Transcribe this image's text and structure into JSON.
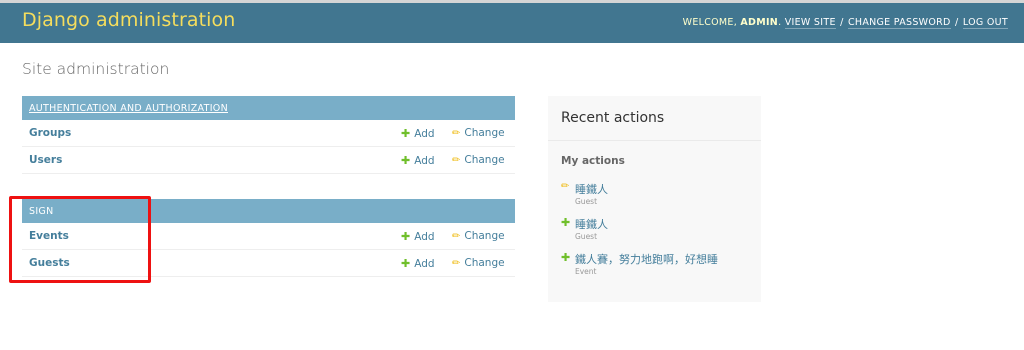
{
  "header": {
    "branding": "Django administration",
    "welcome": "WELCOME,",
    "user": "ADMIN",
    "view_site": "VIEW SITE",
    "change_password": "CHANGE PASSWORD",
    "log_out": "LOG OUT",
    "separator": "/"
  },
  "page_title": "Site administration",
  "apps": [
    {
      "name": "AUTHENTICATION AND AUTHORIZATION",
      "models": [
        {
          "name": "Groups",
          "add": "Add",
          "change": "Change"
        },
        {
          "name": "Users",
          "add": "Add",
          "change": "Change"
        }
      ]
    },
    {
      "name": "SIGN",
      "models": [
        {
          "name": "Events",
          "add": "Add",
          "change": "Change"
        },
        {
          "name": "Guests",
          "add": "Add",
          "change": "Change"
        }
      ]
    }
  ],
  "recent_actions": {
    "title": "Recent actions",
    "subtitle": "My actions",
    "items": [
      {
        "icon": "pencil-icon",
        "title": "睡鐵人",
        "type": "Guest"
      },
      {
        "icon": "plus-icon",
        "title": "睡鐵人",
        "type": "Guest"
      },
      {
        "icon": "plus-icon",
        "title": "鐵人賽，努力地跑啊，好想睡",
        "type": "Event"
      }
    ]
  },
  "colors": {
    "header_bg": "#417690",
    "branding": "#f5dd5d",
    "module_header_bg": "#79aec8",
    "link": "#447e9b",
    "add_icon": "#70bf2b",
    "change_icon": "#efb80b",
    "highlight_box": "#ee1111"
  }
}
